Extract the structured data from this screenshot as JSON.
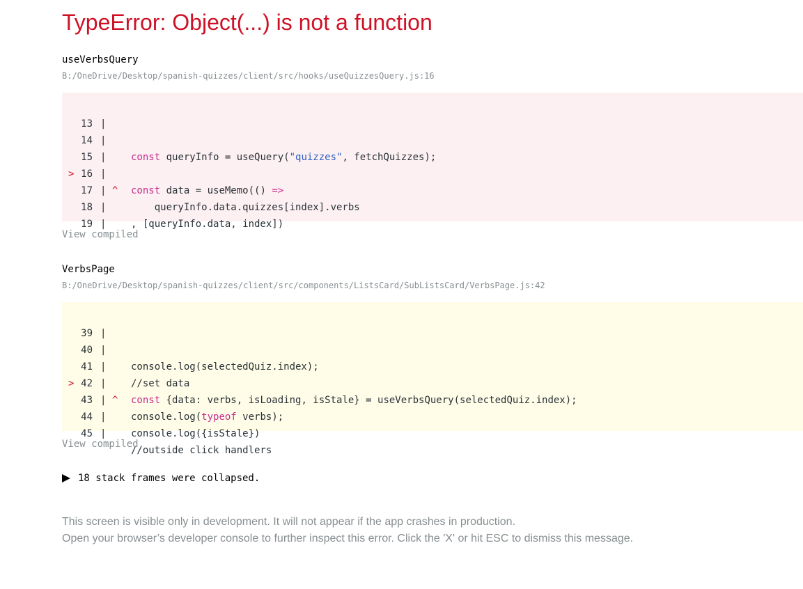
{
  "error": {
    "title": "TypeError: Object(...) is not a function"
  },
  "frames": [
    {
      "function": "useVerbsQuery",
      "file": "B:/OneDrive/Desktop/spanish-quizzes/client/src/hooks/useQuizzesQuery.js:16",
      "view_compiled": "View compiled",
      "lines": [
        {
          "no": "13",
          "marker": "",
          "caret": ""
        },
        {
          "no": "14",
          "marker": "",
          "caret": ""
        },
        {
          "no": "15",
          "marker": "",
          "caret": ""
        },
        {
          "no": "16",
          "marker": ">",
          "caret": ""
        },
        {
          "no": "17",
          "marker": "",
          "caret": "^"
        },
        {
          "no": "18",
          "marker": "",
          "caret": ""
        },
        {
          "no": "19",
          "marker": "",
          "caret": ""
        }
      ],
      "tokens": {
        "l14_kw": "const",
        "l14_a": " queryInfo = useQuery(",
        "l14_str": "\"quizzes\"",
        "l14_b": ", fetchQuizzes);",
        "l16_kw": "const",
        "l16_a": " data = useMemo(() ",
        "l16_arrow": "=>",
        "l17": "    queryInfo.data.quizzes[index].verbs",
        "l18": ", [queryInfo.data, index])"
      }
    },
    {
      "function": "VerbsPage",
      "file": "B:/OneDrive/Desktop/spanish-quizzes/client/src/components/ListsCard/SubListsCard/VerbsPage.js:42",
      "view_compiled": "View compiled",
      "lines": [
        {
          "no": "39",
          "marker": "",
          "caret": ""
        },
        {
          "no": "40",
          "marker": "",
          "caret": ""
        },
        {
          "no": "41",
          "marker": "",
          "caret": ""
        },
        {
          "no": "42",
          "marker": ">",
          "caret": ""
        },
        {
          "no": "43",
          "marker": "",
          "caret": "^"
        },
        {
          "no": "44",
          "marker": "",
          "caret": ""
        },
        {
          "no": "45",
          "marker": "",
          "caret": ""
        }
      ],
      "tokens": {
        "l40": "console.log(selectedQuiz.index);",
        "l41": "//set data",
        "l42_kw": "const",
        "l42_a": " {data: verbs, isLoading, isStale} = useVerbsQuery(selectedQuiz.index);",
        "l43_a": "console.log(",
        "l43_kw": "typeof",
        "l43_b": " verbs);",
        "l44": "console.log({isStale})",
        "l45": "//outside click handlers"
      }
    }
  ],
  "pipe": "|",
  "collapsed": {
    "label": "18 stack frames were collapsed."
  },
  "footer": {
    "line1": "This screen is visible only in development. It will not appear if the app crashes in production.",
    "line2": "Open your browser’s developer console to further inspect this error.  Click the 'X' or hit ESC to dismiss this message."
  },
  "colors": {
    "error_red": "#ce1126",
    "keyword": "#c52d8f",
    "string": "#2c60c4",
    "muted": "#878e91",
    "error_bg": "#fdf0f2",
    "warning_bg": "#fffde8"
  }
}
